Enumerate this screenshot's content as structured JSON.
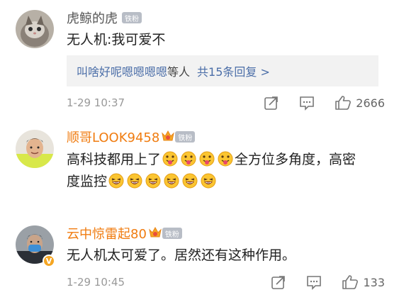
{
  "comments": [
    {
      "username": "虎鲸的虎",
      "badge": "铁粉",
      "text": "无人机:我可爱不",
      "replies": {
        "names": "叫啥好呢嗯嗯嗯嗯",
        "mid": "等人",
        "count_text": "共15条回复 >"
      },
      "time": "1-29 10:37",
      "likes": "2666"
    },
    {
      "username": "顺哥LOOK9458",
      "badge": "铁粉",
      "text_part1": "高科技都用上了",
      "text_part2": "全方位多角度，高密",
      "text_part3": "度监控",
      "emoji_set1": "tongue-emoji",
      "emoji_set2": "laughing-emoji"
    },
    {
      "username": "云中惊雷起80",
      "badge": "铁粉",
      "text": "无人机太可爱了。居然还有这种作用。",
      "time": "1-29 10:45",
      "likes": "133"
    }
  ],
  "colors": {
    "username_gray": "#555555",
    "username_orange": "#f07c10",
    "reply_link": "#4b6ea8",
    "meta_gray": "#999999"
  }
}
